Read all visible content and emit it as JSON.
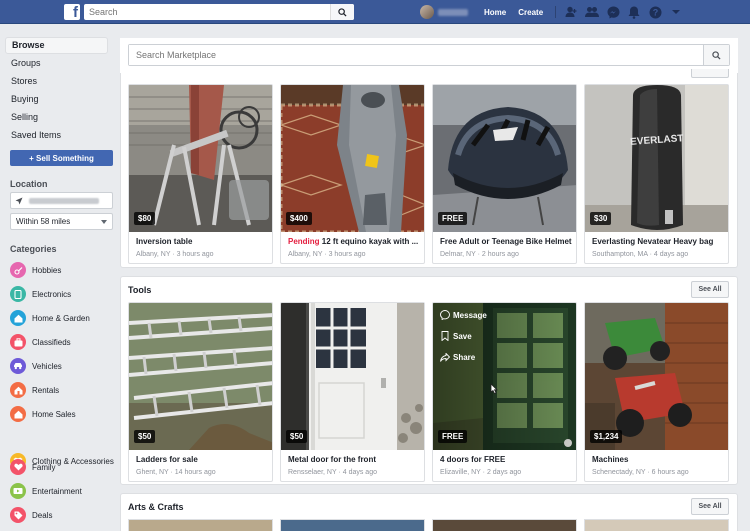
{
  "topbar": {
    "search_placeholder": "Search",
    "nav": [
      "Home",
      "Create"
    ]
  },
  "sidebar": {
    "items": [
      {
        "label": "Browse",
        "active": true
      },
      {
        "label": "Groups"
      },
      {
        "label": "Stores"
      },
      {
        "label": "Buying"
      },
      {
        "label": "Selling"
      },
      {
        "label": "Saved Items"
      }
    ],
    "sell_button": "+ Sell Something",
    "location_label": "Location",
    "radius": "Within 58 miles",
    "categories_label": "Categories",
    "categories": [
      {
        "label": "Hobbies",
        "color": "#e667af",
        "icon": "hobbies-icon"
      },
      {
        "label": "Electronics",
        "color": "#3ab7a5",
        "icon": "electronics-icon"
      },
      {
        "label": "Home & Garden",
        "color": "#24a3d9",
        "icon": "home-garden-icon"
      },
      {
        "label": "Classifieds",
        "color": "#f35369",
        "icon": "classifieds-icon"
      },
      {
        "label": "Vehicles",
        "color": "#6e5ad8",
        "icon": "vehicles-icon"
      },
      {
        "label": "Rentals",
        "color": "#f36d45",
        "icon": "rentals-icon"
      },
      {
        "label": "Home Sales",
        "color": "#f36d45",
        "icon": "home-sales-icon"
      },
      {
        "label": "Clothing & Accessories",
        "color": "#f7b928",
        "icon": "clothing-icon"
      },
      {
        "label": "Family",
        "color": "#f35369",
        "icon": "family-icon"
      },
      {
        "label": "Entertainment",
        "color": "#8bc34a",
        "icon": "entertainment-icon"
      },
      {
        "label": "Deals",
        "color": "#f35369",
        "icon": "deals-icon"
      }
    ]
  },
  "main": {
    "search_placeholder": "Search Marketplace",
    "featured": {
      "cards": [
        {
          "price": "$80",
          "title": "Inversion table",
          "meta": "Albany, NY · 3 hours ago"
        },
        {
          "price": "$400",
          "pending": "Pending",
          "title": " 12 ft equino kayak with ...",
          "meta": "Albany, NY · 3 hours ago"
        },
        {
          "price": "FREE",
          "title": "Free Adult or Teenage Bike Helmet",
          "meta": "Delmar, NY · 2 hours ago"
        },
        {
          "price": "$30",
          "title": "Everlasting Nevatear Heavy bag",
          "meta": "Southampton, MA · 4 days ago"
        }
      ]
    },
    "tools": {
      "title": "Tools",
      "see_all": "See All",
      "cards": [
        {
          "price": "$50",
          "title": "Ladders for sale",
          "meta": "Ghent, NY · 14 hours ago"
        },
        {
          "price": "$50",
          "title": "Metal door for the front",
          "meta": "Rensselaer, NY · 4 days ago"
        },
        {
          "price": "FREE",
          "title": "4 doors for FREE",
          "meta": "Elizaville, NY · 2 days ago"
        },
        {
          "price": "$1,234",
          "title": "Machines",
          "meta": "Schenectady, NY · 6 hours ago"
        }
      ],
      "hover_actions": [
        "Message",
        "Save",
        "Share"
      ]
    },
    "arts": {
      "title": "Arts & Crafts",
      "see_all": "See All"
    }
  }
}
